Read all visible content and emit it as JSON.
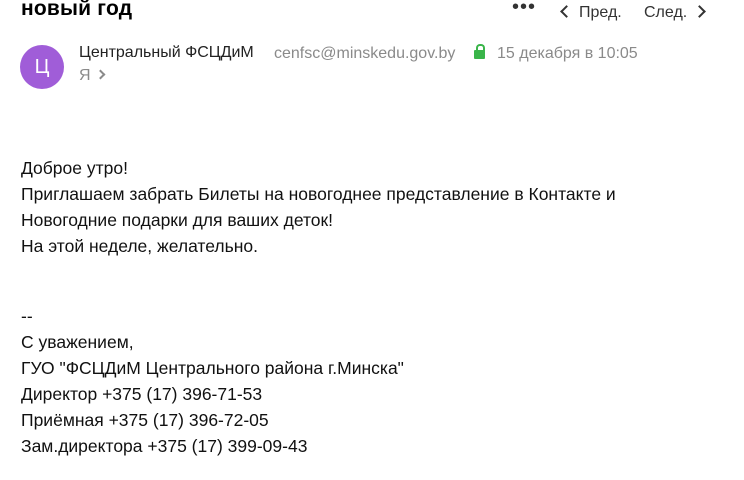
{
  "header": {
    "subject": "новый год",
    "more_label": "•••",
    "prev_label": "Пред.",
    "next_label": "След."
  },
  "sender": {
    "avatar_letter": "Ц",
    "avatar_color": "#a05dd8",
    "name": "Центральный ФСЦДиМ",
    "email": "cenfsc@minskedu.gov.by",
    "date": "15 декабря в 10:05",
    "recipient": "Я"
  },
  "message": {
    "lines": [
      "Доброе утро!",
      "Приглашаем забрать Билеты на новогоднее представление в Контакте и",
      "Новогодние подарки для ваших деток!",
      "На этой неделе, желательно."
    ],
    "signature": [
      "--",
      "С уважением,",
      "ГУО \"ФСЦДиМ Центрального района г.Минска\"",
      "Директор +375 (17) 396-71-53",
      "Приёмная +375 (17) 396-72-05",
      "Зам.директора +375 (17) 399-09-43"
    ]
  }
}
